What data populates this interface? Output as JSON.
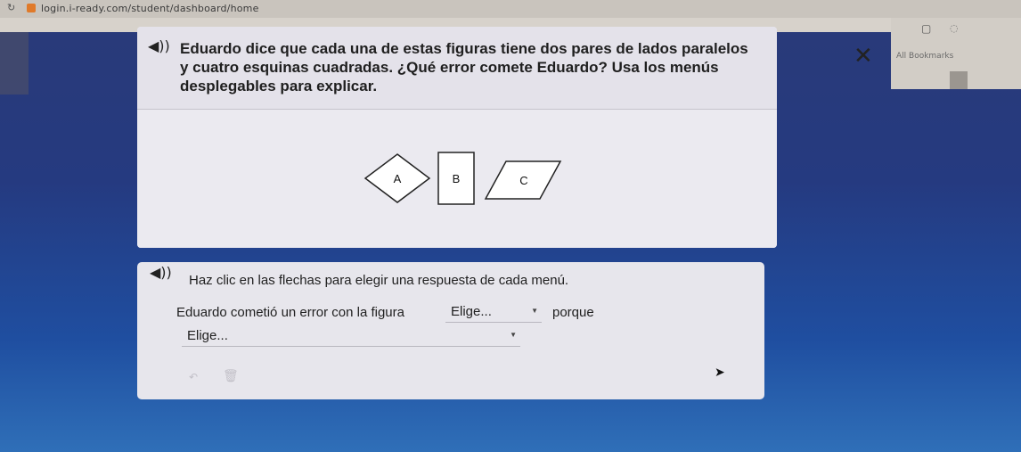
{
  "browser": {
    "url": "login.i-ready.com/student/dashboard/home",
    "bookmarks_label": "All Bookmarks"
  },
  "question": {
    "text_line1": "Eduardo dice que cada una de estas figuras tiene dos pares de lados paralelos",
    "text_line2": "y cuatro esquinas cuadradas. ¿Qué error comete Eduardo? Usa los menús",
    "text_line3": "desplegables para explicar.",
    "figures": [
      {
        "label": "A",
        "shape": "rhombus"
      },
      {
        "label": "B",
        "shape": "rectangle"
      },
      {
        "label": "C",
        "shape": "parallelogram"
      }
    ]
  },
  "answer": {
    "instruction": "Haz clic en las flechas para elegir una respuesta de cada menú.",
    "sentence_start": "Eduardo cometió un error con la figura",
    "dropdown1_value": "Elige...",
    "sentence_mid": "porque",
    "dropdown2_value": "Elige..."
  },
  "colors": {
    "panel": "#e9e8ef",
    "background_top": "#2a3a78",
    "background_bottom": "#2f6fb8"
  }
}
